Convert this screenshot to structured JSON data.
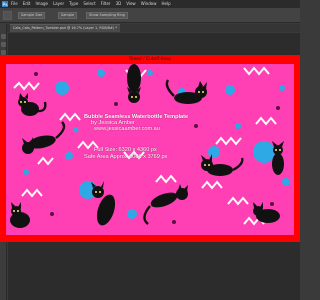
{
  "app": {
    "logo": "Ps",
    "menu": [
      "File",
      "Edit",
      "Image",
      "Layer",
      "Type",
      "Select",
      "Filter",
      "3D",
      "View",
      "Window",
      "Help"
    ],
    "options": {
      "chip_1": "Sample Size",
      "chip_2": "Sample",
      "chip_3": "Show Sampling Ring"
    },
    "document_tab": "Cats_Cats_Pattern_Tumbler.psd @ 16.7% (Layer 1, RGB/8#) *"
  },
  "canvas": {
    "bleed_label": "Bleed / Cutoff Area",
    "artwork_lines": {
      "title": "Bubble Seamless Waterbottle Template",
      "author": "by Jessica Amber",
      "website": "www.jessicaamber.com.au",
      "full_size": "Full Size: 6320 x 4360 px",
      "safe_area": "Safe Area Approx 6088 x 3769 px"
    }
  },
  "colors": {
    "bleed": "#ff0000",
    "artwork_background": "#ff3fb4",
    "accent_blue": "#2ea9e6",
    "ui_dark": "#3a3a3a"
  },
  "icons": [
    "photoshop-logo-icon",
    "move-tool-icon",
    "eyedropper-tool-icon",
    "brush-tool-icon",
    "eraser-tool-icon",
    "type-tool-icon",
    "hand-tool-icon",
    "zoom-tool-icon"
  ]
}
